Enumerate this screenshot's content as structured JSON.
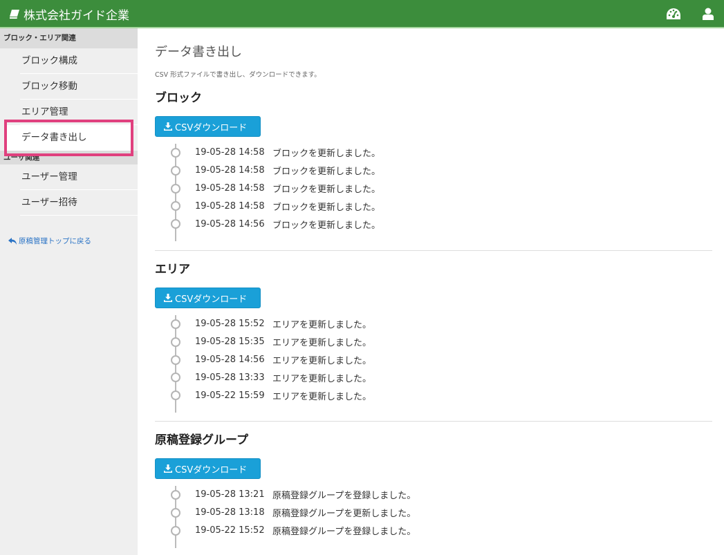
{
  "header": {
    "brand": "株式会社ガイド企業",
    "icons": [
      "book-icon",
      "dashboard-icon",
      "user-icon"
    ]
  },
  "sidebar": {
    "group1_title": "ブロック・エリア関連",
    "group1_items": [
      "ブロック構成",
      "ブロック移動",
      "エリア管理",
      "データ書き出し"
    ],
    "group2_title": "ユーザ関連",
    "group2_items": [
      "ユーザー管理",
      "ユーザー招待"
    ],
    "back_link": "原稿管理トップに戻る",
    "active_item": "データ書き出し"
  },
  "main": {
    "title": "データ書き出し",
    "description": "CSV 形式ファイルで書き出し、ダウンロードできます。",
    "sections": [
      {
        "title": "ブロック",
        "button": "CSVダウンロード",
        "entries": [
          {
            "time": "19-05-28 14:58",
            "message": "ブロックを更新しました。"
          },
          {
            "time": "19-05-28 14:58",
            "message": "ブロックを更新しました。"
          },
          {
            "time": "19-05-28 14:58",
            "message": "ブロックを更新しました。"
          },
          {
            "time": "19-05-28 14:58",
            "message": "ブロックを更新しました。"
          },
          {
            "time": "19-05-28 14:56",
            "message": "ブロックを更新しました。"
          }
        ]
      },
      {
        "title": "エリア",
        "button": "CSVダウンロード",
        "entries": [
          {
            "time": "19-05-28 15:52",
            "message": "エリアを更新しました。"
          },
          {
            "time": "19-05-28 15:35",
            "message": "エリアを更新しました。"
          },
          {
            "time": "19-05-28 14:56",
            "message": "エリアを更新しました。"
          },
          {
            "time": "19-05-28 13:33",
            "message": "エリアを更新しました。"
          },
          {
            "time": "19-05-22 15:59",
            "message": "エリアを更新しました。"
          }
        ]
      },
      {
        "title": "原稿登録グループ",
        "button": "CSVダウンロード",
        "entries": [
          {
            "time": "19-05-28 13:21",
            "message": "原稿登録グループを登録しました。"
          },
          {
            "time": "19-05-28 13:18",
            "message": "原稿登録グループを更新しました。"
          },
          {
            "time": "19-05-22 15:52",
            "message": "原稿登録グループを登録しました。"
          }
        ]
      }
    ]
  },
  "colors": {
    "header_bg": "#3c8d3c",
    "button_bg": "#1aa0d8",
    "highlight": "#e0407e",
    "link": "#2a73c5"
  }
}
